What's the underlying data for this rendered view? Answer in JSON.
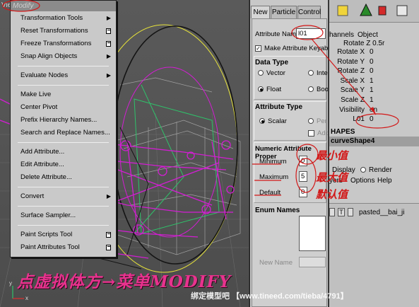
{
  "viewport": {
    "label": "Vie",
    "axis_labels": [
      "y",
      "x"
    ]
  },
  "menu": {
    "title": "Modify",
    "items": [
      {
        "label": "Transformation Tools",
        "marker": "arrow"
      },
      {
        "label": "Reset Transformations",
        "marker": "option"
      },
      {
        "label": "Freeze Transformations",
        "marker": "option"
      },
      {
        "label": "Snap Align Objects",
        "marker": "arrow"
      },
      {
        "sep": true
      },
      {
        "label": "Evaluate Nodes",
        "marker": "arrow"
      },
      {
        "sep": true
      },
      {
        "label": "Make Live"
      },
      {
        "label": "Center Pivot"
      },
      {
        "label": "Prefix Hierarchy Names..."
      },
      {
        "label": "Search and Replace Names..."
      },
      {
        "sep": true
      },
      {
        "label": "Add Attribute..."
      },
      {
        "label": "Edit Attribute..."
      },
      {
        "label": "Delete Attribute..."
      },
      {
        "sep": true
      },
      {
        "label": "Convert",
        "marker": "arrow"
      },
      {
        "sep": true
      },
      {
        "label": "Surface Sampler..."
      },
      {
        "sep": true
      },
      {
        "label": "Paint Scripts Tool",
        "marker": "option"
      },
      {
        "label": "Paint Attributes Tool",
        "marker": "option"
      }
    ]
  },
  "dialog": {
    "tabs": [
      "New",
      "Particle",
      "Control"
    ],
    "attribute_name_label": "Attribute Name",
    "attribute_name_value": "l01",
    "make_keyable_label": "Make Attribute Keyable",
    "data_type_title": "Data Type",
    "data_type_options": [
      "Vector",
      "Integ",
      "Float",
      "Bool"
    ],
    "attribute_type_title": "Attribute Type",
    "attribute_type_options": [
      "Scalar",
      "Per"
    ],
    "add_label": "Add",
    "numeric_title": "Numeric Attribute Proper",
    "minimum_label": "Minimum",
    "minimum_value": "0",
    "maximum_label": "Maximum",
    "maximum_value": "5",
    "default_label": "Default",
    "default_value": "0",
    "enum_title": "Enum Names",
    "new_name_label": "New Name"
  },
  "channel_box": {
    "tabs": [
      "hannels",
      "Object"
    ],
    "partial_row": "Rotate Z  0.5r",
    "attributes": [
      {
        "name": "Rotate X",
        "value": "0"
      },
      {
        "name": "Rotate Y",
        "value": "0"
      },
      {
        "name": "Rotate Z",
        "value": "0"
      },
      {
        "name": "Scale X",
        "value": "1"
      },
      {
        "name": "Scale Y",
        "value": "1"
      },
      {
        "name": "Scale Z",
        "value": "1"
      },
      {
        "name": "Visibility",
        "value": "on"
      },
      {
        "name": "L01",
        "value": "0"
      }
    ],
    "shapes_header": "HAPES",
    "shape_name": "curveShape4",
    "display_label": "Display",
    "render_label": "Render",
    "layer_menu": [
      "yers",
      "Options",
      "Help"
    ],
    "layer_t": "T",
    "layer_name": "pasted__bai_ji"
  },
  "annotations": {
    "min_note": "最小值",
    "max_note": "最大值",
    "default_note": "默认值",
    "caption": "点虚拟体方→菜单MODIFY",
    "watermark": "绑定模型吧 【www.tineed.com/tieba/4791】"
  },
  "colors": {
    "caption": "#e8328e",
    "annotation_red": "#d21818",
    "wire_magenta": "#d21ed2",
    "wire_yellow": "#e6e23a",
    "wire_green": "#2fc26a"
  }
}
